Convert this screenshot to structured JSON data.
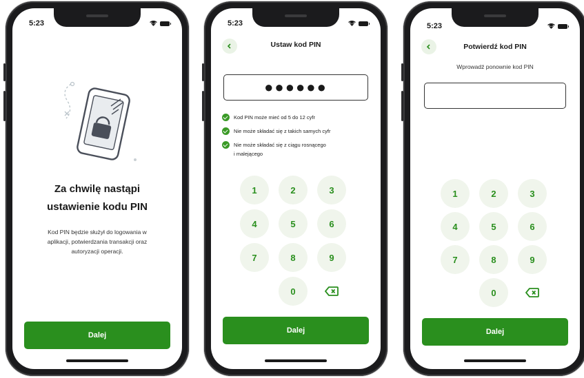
{
  "status": {
    "time": "5:23"
  },
  "screen1": {
    "title_line1": "Za chwilę nastąpi",
    "title_line2": "ustawienie kodu PIN",
    "desc_line1": "Kod PIN będzie służył do logowania w",
    "desc_line2": "aplikacji, potwierdzania transakcji oraz",
    "desc_line3": "autoryzacji operacji.",
    "button": "Dalej"
  },
  "screen2": {
    "title": "Ustaw kod PIN",
    "pin_masked": "●●●●●●",
    "rules": [
      {
        "line1": "Kod PIN może mieć od 5 do 12 cyfr",
        "line2": ""
      },
      {
        "line1": "Nie może składać się z takich samych cyfr",
        "line2": ""
      },
      {
        "line1": "Nie może składać się z ciągu rosnącego",
        "line2": "i malejącego"
      }
    ],
    "button": "Dalej"
  },
  "screen3": {
    "title": "Potwierdź kod PIN",
    "subtitle": "Wprowadź ponownie kod PIN",
    "button": "Dalej"
  },
  "keypad": {
    "keys": [
      "1",
      "2",
      "3",
      "4",
      "5",
      "6",
      "7",
      "8",
      "9",
      "0"
    ],
    "delete_icon": "backspace-icon"
  },
  "colors": {
    "accent": "#2a8f1e",
    "key_bg": "#f0f5ec",
    "back_bg": "#eaf3e6"
  }
}
